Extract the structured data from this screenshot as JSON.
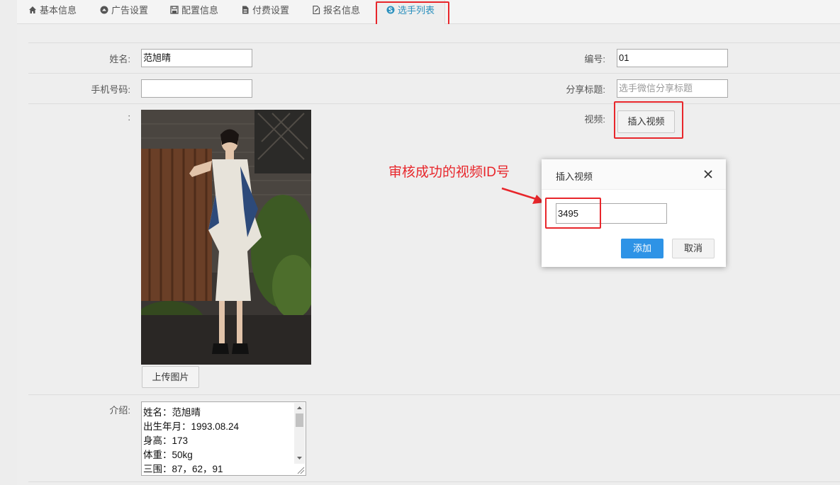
{
  "tabs": [
    {
      "label": "基本信息",
      "icon": "home-icon"
    },
    {
      "label": "广告设置",
      "icon": "circle-arrow-icon"
    },
    {
      "label": "配置信息",
      "icon": "save-icon"
    },
    {
      "label": "付费设置",
      "icon": "document-icon"
    },
    {
      "label": "报名信息",
      "icon": "edit-file-icon"
    },
    {
      "label": "选手列表",
      "icon": "skype-icon",
      "active": true
    }
  ],
  "form": {
    "name_label": "姓名:",
    "name_value": "范旭晴",
    "number_label": "编号:",
    "number_value": "01",
    "phone_label": "手机号码:",
    "phone_value": "",
    "share_title_label": "分享标题:",
    "share_title_placeholder": "选手微信分享标题",
    "image_label": ":",
    "video_label": "视频:",
    "insert_video_button": "插入视频",
    "upload_image_button": "上传图片",
    "intro_label": "介绍:",
    "intro_lines": [
      "姓名：范旭晴",
      "出生年月：1993.08.24",
      "身高：173",
      "体重：50kg",
      "三围：87，62，91"
    ]
  },
  "annotation": {
    "text": "审核成功的视频ID号"
  },
  "modal": {
    "title": "插入视频",
    "video_id_value": "3495",
    "add_button": "添加",
    "cancel_button": "取消"
  },
  "colors": {
    "accent": "#2e93e6",
    "annotation_red": "#e8262b",
    "active_tab": "#2a8fbd"
  }
}
